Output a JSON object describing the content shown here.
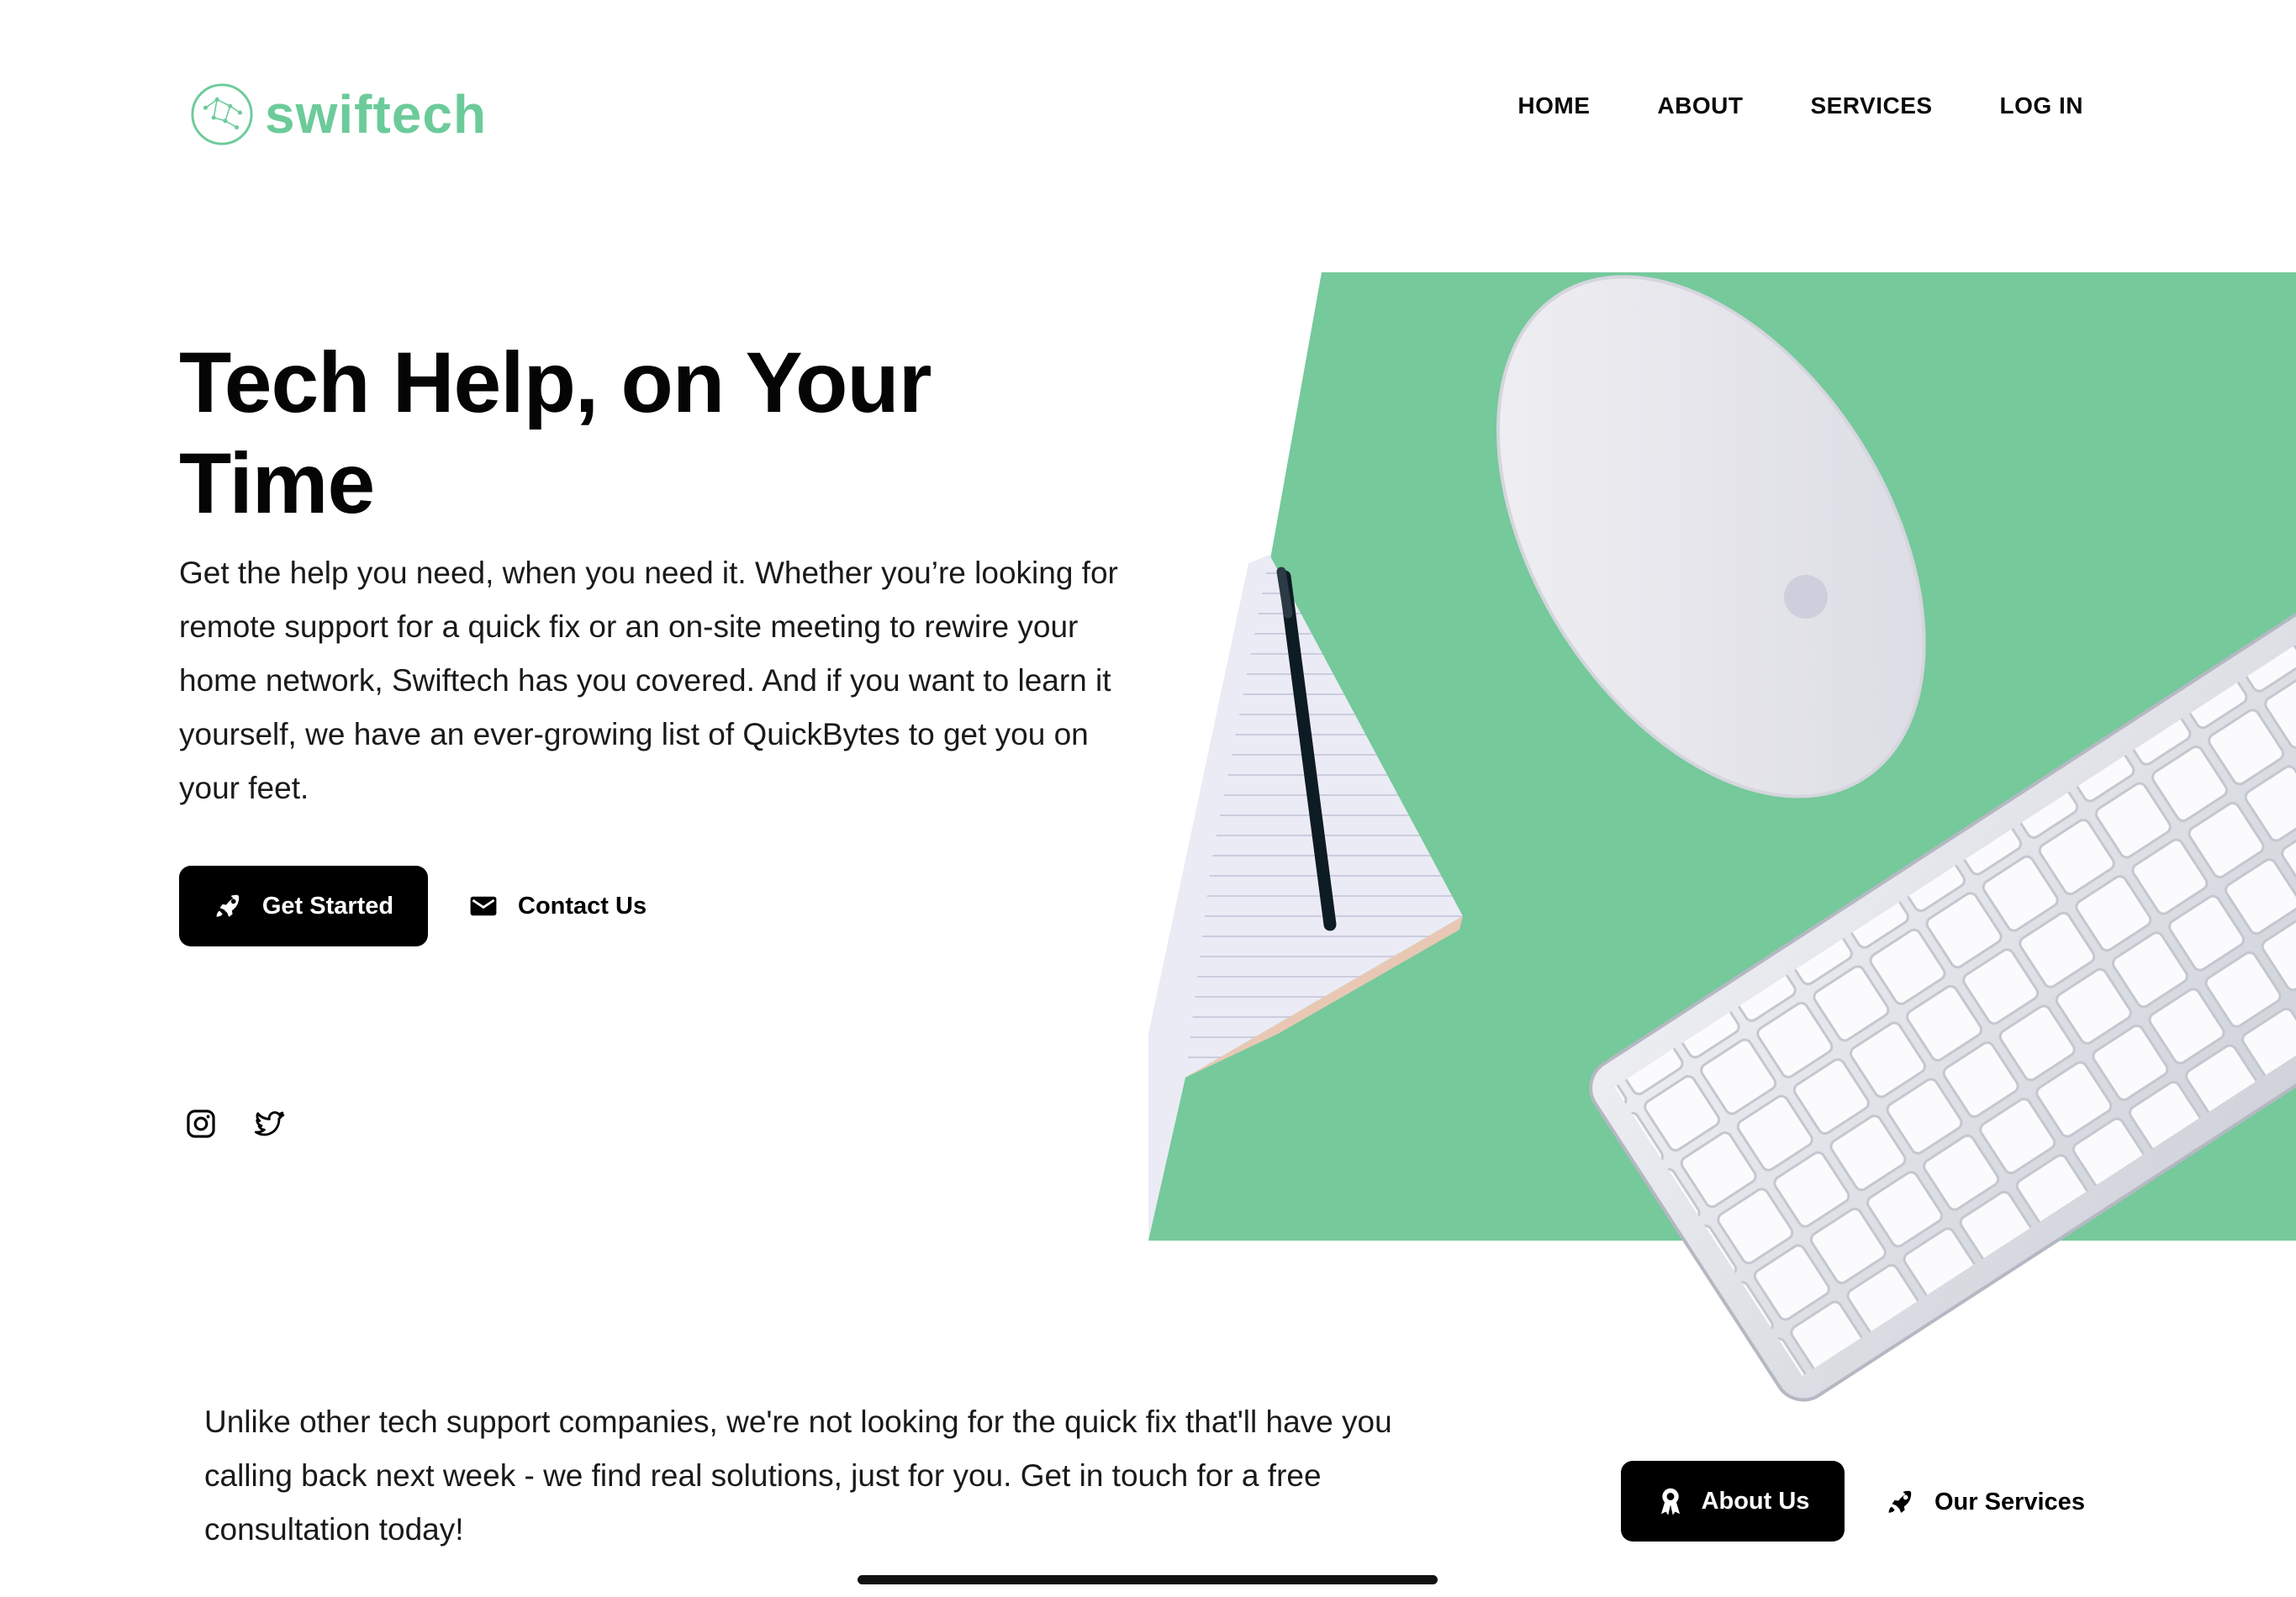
{
  "brand": {
    "name": "swiftech",
    "color": "#6ccb9a",
    "logo_icon": "constellation-globe-icon"
  },
  "nav": [
    {
      "label": "HOME"
    },
    {
      "label": "ABOUT"
    },
    {
      "label": "SERVICES"
    },
    {
      "label": "LOG IN"
    }
  ],
  "hero": {
    "title": "Tech Help, on Your Time",
    "description": "Get the help you need, when you need it. Whether you’re looking for remote support for a quick fix or an on-site meeting to rewire your home network, Swiftech has you covered. And if you want to learn it yourself, we have an ever-growing list of QuickBytes to get you on your feet.",
    "primary_button": {
      "label": "Get Started",
      "icon": "rocket-icon"
    },
    "secondary_button": {
      "label": "Contact Us",
      "icon": "mail-icon"
    },
    "image": "green desk with notebook, pen, mouse and keyboard",
    "accent_color": "#75c99b"
  },
  "social": [
    {
      "icon": "instagram-icon"
    },
    {
      "icon": "twitter-icon"
    }
  ],
  "intro": {
    "text": "Unlike other tech support companies, we're not looking for the quick fix that'll have you calling back next week - we find real solutions, just for you. Get in touch for a free consultation today!",
    "primary_button": {
      "label": "About Us",
      "icon": "award-icon"
    },
    "secondary_button": {
      "label": "Our Services",
      "icon": "rocket-icon"
    }
  }
}
